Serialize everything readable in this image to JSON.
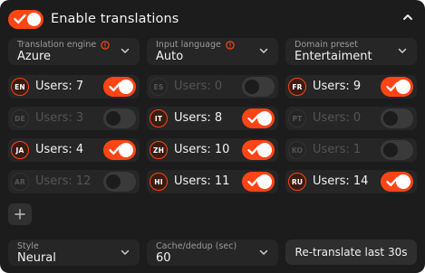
{
  "header": {
    "title": "Enable translations",
    "enabled": true,
    "collapse_icon": "chevron-up-icon"
  },
  "settings": {
    "engine": {
      "label": "Translation engine",
      "value": "Azure",
      "info_icon": "info-icon"
    },
    "input_language": {
      "label": "Input language",
      "value": "Auto",
      "info_icon": "info-icon"
    },
    "domain_preset": {
      "label": "Domain preset",
      "value": "Entertaiment"
    }
  },
  "languages": [
    {
      "code": "EN",
      "users": "Users: 7",
      "enabled": true
    },
    {
      "code": "ES",
      "users": "Users: 0",
      "enabled": false
    },
    {
      "code": "FR",
      "users": "Users: 9",
      "enabled": true
    },
    {
      "code": "DE",
      "users": "Users: 3",
      "enabled": false
    },
    {
      "code": "IT",
      "users": "Users: 8",
      "enabled": true
    },
    {
      "code": "PT",
      "users": "Users: 0",
      "enabled": false
    },
    {
      "code": "JA",
      "users": "Users: 4",
      "enabled": true
    },
    {
      "code": "ZH",
      "users": "Users: 10",
      "enabled": true
    },
    {
      "code": "KO",
      "users": "Users: 1",
      "enabled": false
    },
    {
      "code": "AR",
      "users": "Users: 12",
      "enabled": false
    },
    {
      "code": "HI",
      "users": "Users: 11",
      "enabled": true
    },
    {
      "code": "RU",
      "users": "Users: 14",
      "enabled": true
    }
  ],
  "add_button_icon": "plus-icon",
  "bottom": {
    "style": {
      "label": "Style",
      "value": "Neural"
    },
    "cache": {
      "label": "Cache/dedup (sec)",
      "value": "60"
    },
    "retranslate_label": "Re-translate last 30s"
  },
  "colors": {
    "accent": "#ff4415",
    "panel_bg": "#1c1c1c",
    "cell_bg": "#262626",
    "toggle_off": "#3a3a3a"
  }
}
